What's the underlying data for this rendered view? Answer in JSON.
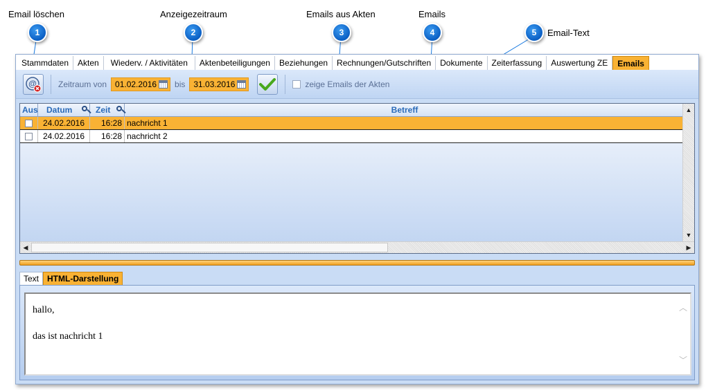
{
  "callouts": [
    {
      "number": "1",
      "label": "Email löschen"
    },
    {
      "number": "2",
      "label": "Anzeigezeitraum"
    },
    {
      "number": "3",
      "label": "Emails aus Akten"
    },
    {
      "number": "4",
      "label": "Emails"
    },
    {
      "number": "5",
      "label": "Email-Text"
    }
  ],
  "tabs": [
    {
      "label": "Stammdaten"
    },
    {
      "label": "Akten"
    },
    {
      "label": "Wiederv. / Aktivitäten"
    },
    {
      "label": "Aktenbeteiligungen"
    },
    {
      "label": "Beziehungen"
    },
    {
      "label": "Rechnungen/Gutschriften"
    },
    {
      "label": "Dokumente"
    },
    {
      "label": "Zeiterfassung"
    },
    {
      "label": "Auswertung ZE"
    },
    {
      "label": "Emails",
      "active": true
    }
  ],
  "toolbar": {
    "zeitraum_label": "Zeitraum von",
    "date_from": "01.02.2016",
    "bis_label": "bis",
    "date_to": "31.03.2016",
    "show_akten_emails_label": "zeige Emails der Akten",
    "show_akten_emails_checked": false,
    "delete_icon": "email-delete-icon",
    "apply_icon": "checkmark-icon"
  },
  "grid": {
    "columns": [
      "Aus",
      "Datum",
      "Zeit",
      "Betreff"
    ],
    "rows": [
      {
        "aus": false,
        "datum": "24.02.2016",
        "zeit": "16:28",
        "betreff": "nachricht 1",
        "selected": true
      },
      {
        "aus": false,
        "datum": "24.02.2016",
        "zeit": "16:28",
        "betreff": "nachricht 2",
        "selected": false
      }
    ]
  },
  "detail": {
    "tabs": [
      {
        "label": "Text"
      },
      {
        "label": "HTML-Darstellung",
        "active": true
      }
    ],
    "body_line1": "hallo,",
    "body_line2": "das ist nachricht 1"
  },
  "colors": {
    "accent": "#f9b234",
    "panel": "#c9dcf5",
    "badge": "#0b5fc4",
    "header_text": "#2a6ab8"
  }
}
